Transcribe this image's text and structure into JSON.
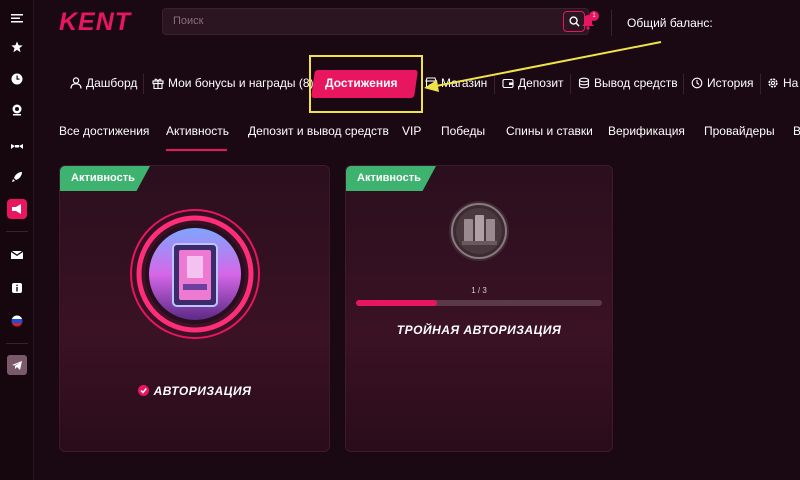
{
  "header": {
    "logo": "KENT",
    "search_placeholder": "Поиск",
    "notification_count": "1",
    "balance_label": "Общий баланс:"
  },
  "nav": {
    "items": [
      {
        "label": "Дашборд",
        "icon": "user-icon"
      },
      {
        "label": "Мои бонусы и награды (8)",
        "icon": "gift-icon"
      },
      {
        "label": "Достижения",
        "icon": "trophy-icon",
        "active": true
      },
      {
        "label": "Магазин",
        "icon": "shop-icon"
      },
      {
        "label": "Депозит",
        "icon": "wallet-icon"
      },
      {
        "label": "Вывод средств",
        "icon": "coins-icon"
      },
      {
        "label": "История",
        "icon": "history-icon"
      },
      {
        "label": "На",
        "icon": "gear-icon"
      }
    ]
  },
  "filters": {
    "items": [
      {
        "label": "Все достижения"
      },
      {
        "label": "Активность",
        "active": true
      },
      {
        "label": "Депозит и вывод средств"
      },
      {
        "label": "VIP"
      },
      {
        "label": "Победы"
      },
      {
        "label": "Спины и ставки"
      },
      {
        "label": "Верификация"
      },
      {
        "label": "Провайдеры"
      },
      {
        "label": "В"
      }
    ]
  },
  "cards": [
    {
      "tag": "Активность",
      "title": "АВТОРИЗАЦИЯ",
      "completed": true
    },
    {
      "tag": "Активность",
      "title": "ТРОЙНАЯ АВТОРИЗАЦИЯ",
      "progress_text": "1 / 3",
      "progress_fraction": 0.33
    }
  ],
  "colors": {
    "accent": "#e8155f",
    "tag_green": "#3db36f",
    "highlight": "#f0e34a"
  }
}
